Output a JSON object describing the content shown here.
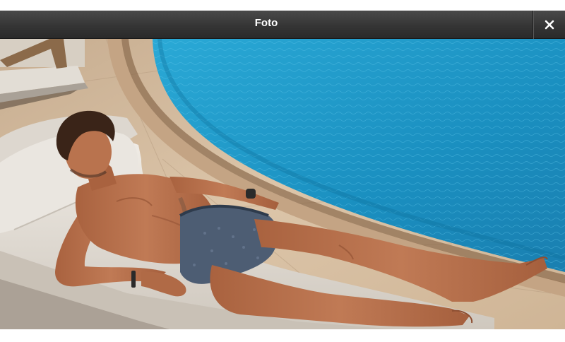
{
  "header": {
    "title": "Foto",
    "close_icon": "close-icon"
  },
  "photo": {
    "subject": "photo",
    "colors": {
      "pool_water": "#1f9cc8",
      "pool_deck": "#d9c1a5",
      "lounger_cushion": "#e6e2dc",
      "skin": "#b5714d",
      "hair": "#3a2418",
      "trunks": "#4d5d73",
      "header_bg": "#3a3a3a"
    }
  }
}
